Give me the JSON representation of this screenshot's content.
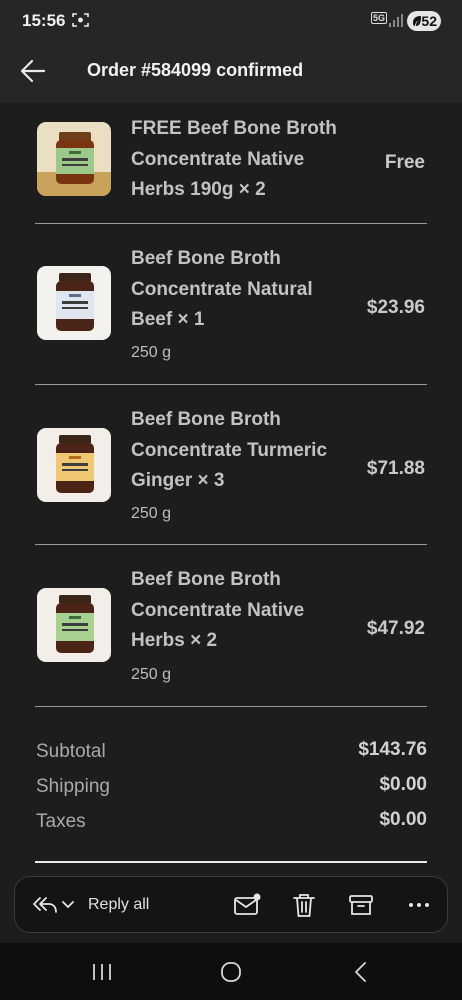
{
  "status_bar": {
    "time": "15:56",
    "network": "5G",
    "battery": "52"
  },
  "header": {
    "title": "Order #584099 confirmed"
  },
  "items": [
    {
      "name": "FREE Beef Bone Broth Concentrate Native Herbs 190g × 2",
      "weight": "",
      "price": "Free",
      "jar_label": "BEEF BONE BROTH",
      "label_color": "#9cc98a"
    },
    {
      "name": "Beef Bone Broth Concentrate Natural Beef × 1",
      "weight": "250 g",
      "price": "$23.96",
      "jar_label": "BEEF BONE BROTH",
      "label_color": "#dfe6ef"
    },
    {
      "name": "Beef Bone Broth Concentrate Turmeric Ginger × 3",
      "weight": "250 g",
      "price": "$71.88",
      "jar_label": "BEEF BONE BROTH",
      "label_color": "#f0c874"
    },
    {
      "name": "Beef Bone Broth Concentrate Native Herbs × 2",
      "weight": "250 g",
      "price": "$47.92",
      "jar_label": "BEEF BONE BROTH",
      "label_color": "#a8d08e"
    }
  ],
  "totals": {
    "subtotal_label": "Subtotal",
    "subtotal": "$143.76",
    "shipping_label": "Shipping",
    "shipping": "$0.00",
    "taxes_label": "Taxes",
    "taxes": "$0.00"
  },
  "action_bar": {
    "reply_label": "Reply all"
  }
}
